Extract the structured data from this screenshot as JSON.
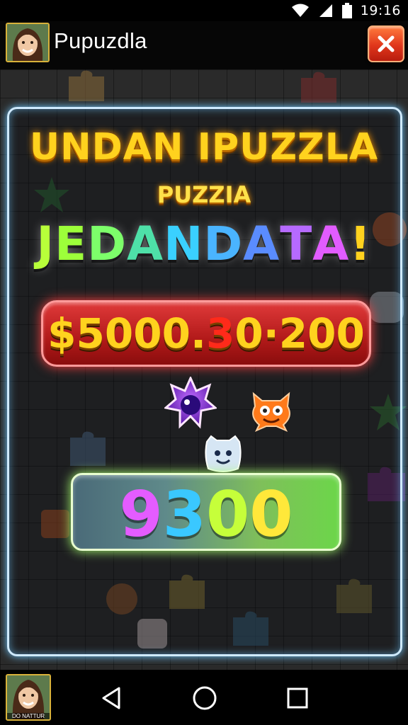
{
  "status_bar": {
    "time": "19:16",
    "icons": [
      "wifi-icon",
      "signal-icon",
      "battery-icon"
    ]
  },
  "header": {
    "title": "Pupuzdla",
    "close_icon": "close-icon",
    "close_color": "#e0361b"
  },
  "promo": {
    "line1": "UNDAN IPUZZLA",
    "line2": "PUZZIA",
    "line3": [
      {
        "char": "J",
        "color": "#b8ff3a"
      },
      {
        "char": "E",
        "color": "#9dff3a"
      },
      {
        "char": "D",
        "color": "#7dff6a"
      },
      {
        "char": "A",
        "color": "#4ee0a8"
      },
      {
        "char": "N",
        "color": "#3ad0ff"
      },
      {
        "char": "D",
        "color": "#4ab4ff"
      },
      {
        "char": "A",
        "color": "#5a8cff"
      },
      {
        "char": "T",
        "color": "#b66aff"
      },
      {
        "char": "A",
        "color": "#e25cff"
      },
      {
        "char": "!",
        "color": "#ffd21e"
      }
    ]
  },
  "prize": {
    "part1": "$5000.",
    "part2": "3",
    "part3": "0·200"
  },
  "score": {
    "digits": [
      {
        "char": "9",
        "color": "#e45cff"
      },
      {
        "char": "3",
        "color": "#3ac8ff"
      },
      {
        "char": "0",
        "color": "#c6ff3a"
      },
      {
        "char": "0",
        "color": "#ffe83a"
      }
    ]
  },
  "profile": {
    "caption": "DO NATTUR"
  },
  "nav": {
    "back_icon": "back-triangle-icon",
    "home_icon": "home-circle-icon",
    "recents_icon": "recents-square-icon"
  }
}
